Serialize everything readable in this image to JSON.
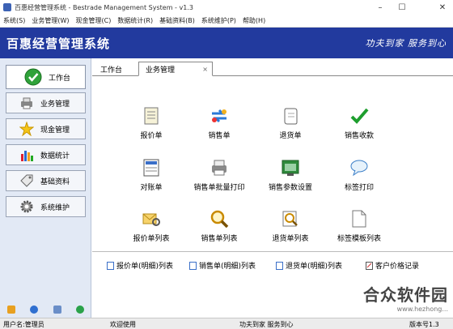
{
  "window": {
    "title": "百惠经营管理系统 - Bestrade Management System - v1.3"
  },
  "menu": [
    "系统(S)",
    "业务管理(W)",
    "现金管理(C)",
    "数据统计(R)",
    "基础资料(B)",
    "系统维护(P)",
    "帮助(H)"
  ],
  "banner": {
    "title": "百惠经营管理系统",
    "slogan": "功夫到家 服务到心"
  },
  "sidebar": {
    "items": [
      {
        "label": "工作台"
      },
      {
        "label": "业务管理"
      },
      {
        "label": "现金管理"
      },
      {
        "label": "数据统计"
      },
      {
        "label": "基础资料"
      },
      {
        "label": "系统维护"
      }
    ]
  },
  "tabs": {
    "workbench": "工作台",
    "business": "业务管理",
    "close": "×"
  },
  "actions": [
    {
      "label": "报价单"
    },
    {
      "label": "销售单"
    },
    {
      "label": "退货单"
    },
    {
      "label": "销售收款"
    },
    {
      "label": "对账单"
    },
    {
      "label": "销售单批量打印"
    },
    {
      "label": "销售参数设置"
    },
    {
      "label": "标签打印"
    },
    {
      "label": "报价单列表"
    },
    {
      "label": "销售单列表"
    },
    {
      "label": "退货单列表"
    },
    {
      "label": "标签模板列表"
    }
  ],
  "links": [
    {
      "label": "报价单(明细)列表"
    },
    {
      "label": "销售单(明细)列表"
    },
    {
      "label": "退货单(明细)列表"
    },
    {
      "label": "客户价格记录"
    }
  ],
  "status": {
    "user": "用户名:管理员",
    "welcome": "欢迎使用",
    "slogan": "功夫到家 服务到心",
    "version": "版本号1.3"
  },
  "watermark": {
    "name": "合众软件园",
    "url": "www.hezhong..."
  },
  "colors": {
    "banner": "#223a9e",
    "sidebar": "#e2e9f5"
  }
}
